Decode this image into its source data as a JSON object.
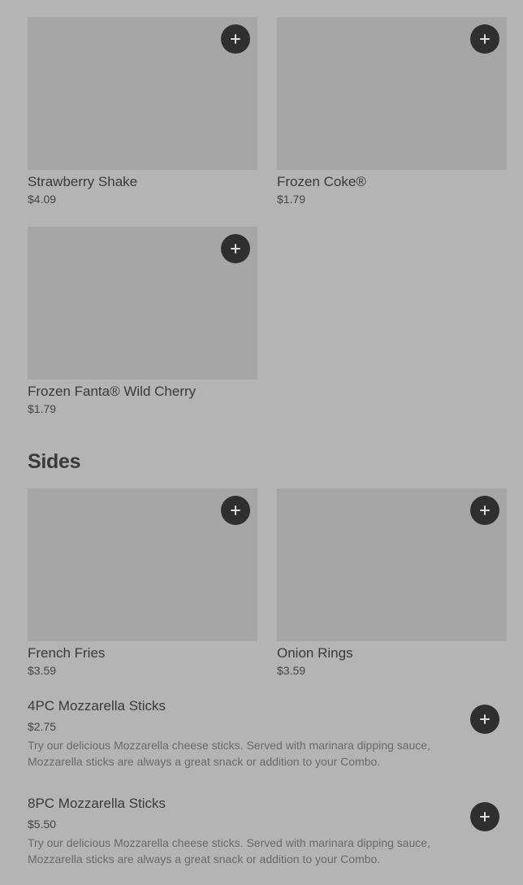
{
  "drinks": [
    {
      "name": "Strawberry Shake",
      "price": "$4.09"
    },
    {
      "name": "Frozen Coke®",
      "price": "$1.79"
    },
    {
      "name": "Frozen Fanta® Wild Cherry",
      "price": "$1.79"
    }
  ],
  "sides_section": {
    "title": "Sides",
    "cards": [
      {
        "name": "French Fries",
        "price": "$3.59"
      },
      {
        "name": "Onion Rings",
        "price": "$3.59"
      }
    ],
    "list": [
      {
        "name": "4PC Mozzarella Sticks",
        "price": "$2.75",
        "description": "Try our delicious Mozzarella cheese sticks. Served with marinara dipping sauce, Mozzarella sticks are always a great snack or addition to your Combo."
      },
      {
        "name": "8PC Mozzarella Sticks",
        "price": "$5.50",
        "description": "Try our delicious Mozzarella cheese sticks. Served with marinara dipping sauce, Mozzarella sticks are always a great snack or addition to your Combo."
      }
    ]
  },
  "icons": {
    "add": "plus-icon"
  },
  "colors": {
    "page_bg": "#b4b4b4",
    "image_placeholder": "#a6a6a6",
    "add_button": "#2f2f2f"
  }
}
